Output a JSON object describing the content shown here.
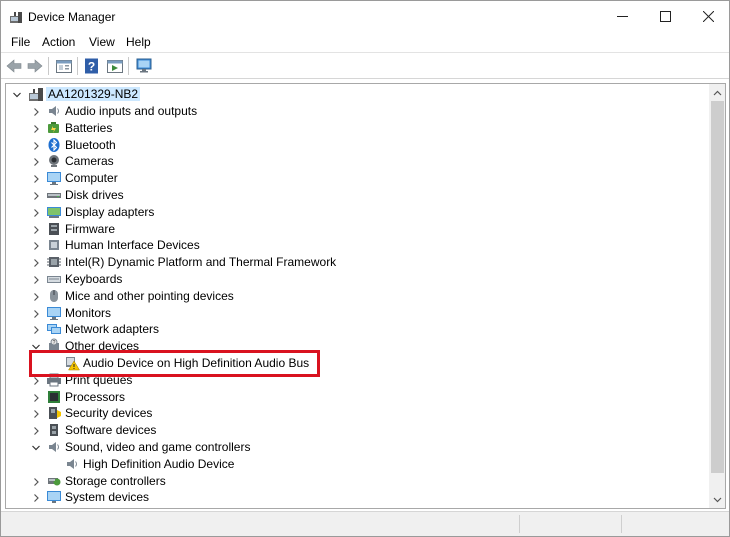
{
  "window": {
    "title": "Device Manager",
    "icon": "device-manager-icon"
  },
  "menu": {
    "items": [
      "File",
      "Action",
      "View",
      "Help"
    ]
  },
  "toolbar": {
    "buttons": [
      "back-arrow-icon",
      "forward-arrow-icon",
      "properties-icon",
      "help-icon",
      "update-driver-icon",
      "scan-hardware-icon"
    ]
  },
  "tree": {
    "root": {
      "label": "AA1201329-NB2",
      "expanded": true,
      "icon": "computer-tower-icon"
    },
    "items": [
      {
        "label": "Audio inputs and outputs",
        "icon": "speaker-icon",
        "state": "collapsed"
      },
      {
        "label": "Batteries",
        "icon": "battery-icon",
        "state": "collapsed"
      },
      {
        "label": "Bluetooth",
        "icon": "bluetooth-icon",
        "state": "collapsed"
      },
      {
        "label": "Cameras",
        "icon": "camera-icon",
        "state": "collapsed"
      },
      {
        "label": "Computer",
        "icon": "monitor-icon",
        "state": "collapsed"
      },
      {
        "label": "Disk drives",
        "icon": "disk-drive-icon",
        "state": "collapsed"
      },
      {
        "label": "Display adapters",
        "icon": "display-adapter-icon",
        "state": "collapsed"
      },
      {
        "label": "Firmware",
        "icon": "firmware-icon",
        "state": "collapsed"
      },
      {
        "label": "Human Interface Devices",
        "icon": "hid-icon",
        "state": "collapsed"
      },
      {
        "label": "Intel(R) Dynamic Platform and Thermal Framework",
        "icon": "chip-icon",
        "state": "collapsed"
      },
      {
        "label": "Keyboards",
        "icon": "keyboard-icon",
        "state": "collapsed"
      },
      {
        "label": "Mice and other pointing devices",
        "icon": "mouse-icon",
        "state": "collapsed"
      },
      {
        "label": "Monitors",
        "icon": "monitor-icon",
        "state": "collapsed"
      },
      {
        "label": "Network adapters",
        "icon": "network-icon",
        "state": "collapsed"
      },
      {
        "label": "Other devices",
        "icon": "unknown-device-icon",
        "state": "expanded"
      },
      {
        "label": "Audio Device on High Definition Audio Bus",
        "icon": "warning-device-icon",
        "state": "child"
      },
      {
        "label": "Print queues",
        "icon": "printer-icon",
        "state": "collapsed"
      },
      {
        "label": "Processors",
        "icon": "processor-icon",
        "state": "collapsed"
      },
      {
        "label": "Security devices",
        "icon": "security-icon",
        "state": "collapsed"
      },
      {
        "label": "Software devices",
        "icon": "software-device-icon",
        "state": "collapsed"
      },
      {
        "label": "Sound, video and game controllers",
        "icon": "speaker-icon",
        "state": "expanded"
      },
      {
        "label": "High Definition Audio Device",
        "icon": "speaker-icon",
        "state": "child"
      },
      {
        "label": "Storage controllers",
        "icon": "storage-icon",
        "state": "collapsed"
      },
      {
        "label": "System devices",
        "icon": "system-device-icon",
        "state": "collapsed"
      }
    ]
  },
  "annotation": {
    "highlight_color": "#d9121f",
    "highlighted_item": "Audio Device on High Definition Audio Bus"
  },
  "colors": {
    "selection": "#cce8ff",
    "scrollbar_track": "#f0f0f0",
    "scrollbar_thumb": "#cdcdcd"
  }
}
